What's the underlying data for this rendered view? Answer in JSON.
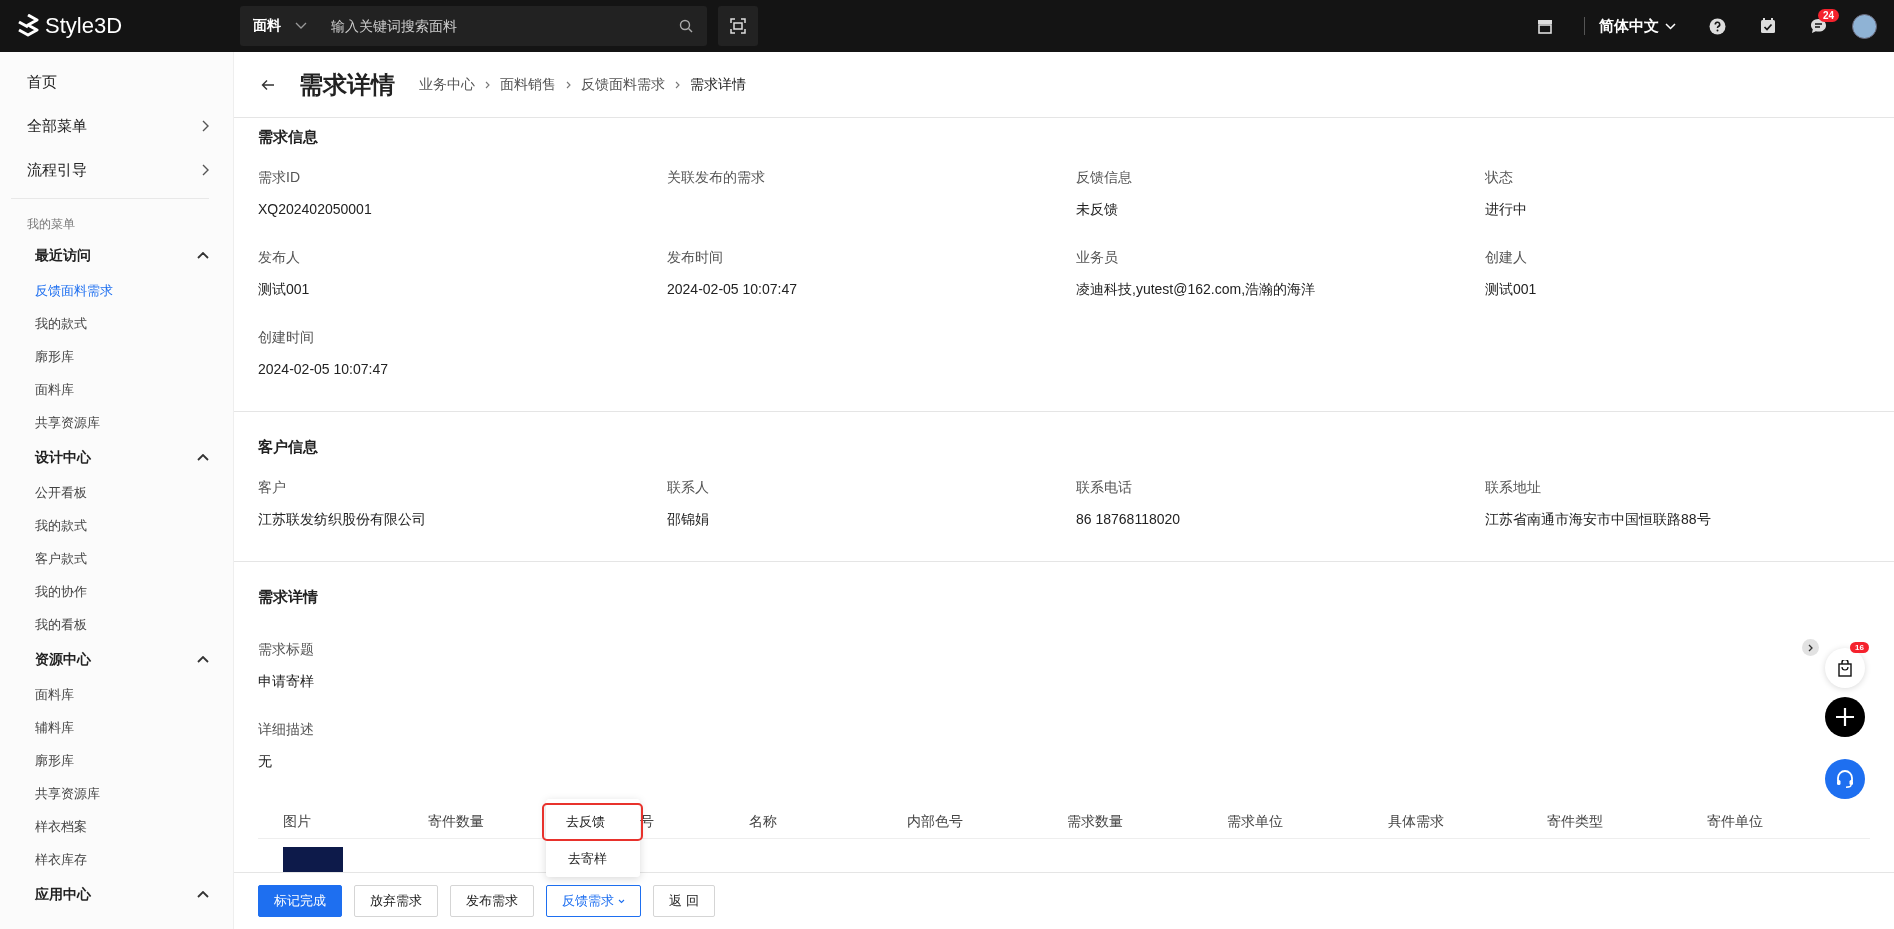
{
  "topbar": {
    "logo": "Style3D",
    "search": {
      "scope": "面料",
      "placeholder": "输入关键词搜索面料"
    },
    "language": "简体中文",
    "message_badge": "24"
  },
  "sidebar": {
    "top_items": [
      {
        "label": "首页",
        "expandable": false
      },
      {
        "label": "全部菜单",
        "expandable": true
      },
      {
        "label": "流程引导",
        "expandable": true
      }
    ],
    "section_label": "我的菜单",
    "groups": [
      {
        "title": "最近访问",
        "expanded": true,
        "items": [
          {
            "label": "反馈面料需求",
            "selected": true
          },
          {
            "label": "我的款式",
            "selected": false
          },
          {
            "label": "廓形库",
            "selected": false
          },
          {
            "label": "面料库",
            "selected": false
          },
          {
            "label": "共享资源库",
            "selected": false
          }
        ]
      },
      {
        "title": "设计中心",
        "expanded": true,
        "items": [
          {
            "label": "公开看板",
            "selected": false
          },
          {
            "label": "我的款式",
            "selected": false
          },
          {
            "label": "客户款式",
            "selected": false
          },
          {
            "label": "我的协作",
            "selected": false
          },
          {
            "label": "我的看板",
            "selected": false
          }
        ]
      },
      {
        "title": "资源中心",
        "expanded": true,
        "items": [
          {
            "label": "面料库",
            "selected": false
          },
          {
            "label": "辅料库",
            "selected": false
          },
          {
            "label": "廓形库",
            "selected": false
          },
          {
            "label": "共享资源库",
            "selected": false
          },
          {
            "label": "样衣档案",
            "selected": false
          },
          {
            "label": "样衣库存",
            "selected": false
          }
        ]
      },
      {
        "title": "应用中心",
        "expanded": true
      }
    ]
  },
  "header": {
    "title": "需求详情",
    "breadcrumb": [
      "业务中心",
      "面料销售",
      "反馈面料需求",
      "需求详情"
    ]
  },
  "sections": [
    {
      "title": "需求信息",
      "fields": [
        {
          "label": "需求ID",
          "value": "XQ202402050001"
        },
        {
          "label": "关联发布的需求"
        },
        {
          "label": "反馈信息",
          "value": "未反馈"
        },
        {
          "label": "状态",
          "value": "进行中"
        },
        {
          "label": "发布人",
          "value": "测试001"
        },
        {
          "label": "发布时间",
          "value": "2024-02-05 10:07:47"
        },
        {
          "label": "业务员",
          "value": "凌迪科技,yutest@162.com,浩瀚的海洋"
        },
        {
          "label": "创建人",
          "value": "测试001"
        },
        {
          "label": "创建时间",
          "value": "2024-02-05 10:07:47"
        }
      ]
    },
    {
      "title": "客户信息",
      "fields": [
        {
          "label": "客户",
          "value": "江苏联发纺织股份有限公司"
        },
        {
          "label": "联系人",
          "value": "邵锦娟"
        },
        {
          "label": "联系电话",
          "value": "86 18768118020"
        },
        {
          "label": "联系地址",
          "value": "江苏省南通市海安市中国恒联路88号"
        }
      ]
    }
  ],
  "detail": {
    "title": "需求详情",
    "fields": [
      {
        "label": "需求标题",
        "value": "申请寄样"
      },
      {
        "label": "详细描述",
        "value": "无"
      }
    ],
    "table": {
      "columns": [
        "图片",
        "寄件数量",
        "号",
        "名称",
        "内部色号",
        "需求数量",
        "需求单位",
        "具体需求",
        "寄件类型",
        "寄件单位"
      ]
    }
  },
  "floating": {
    "cart_badge": "16"
  },
  "actions": [
    {
      "label": "标记完成",
      "kind": "primary"
    },
    {
      "label": "放弃需求",
      "kind": "default"
    },
    {
      "label": "发布需求",
      "kind": "default"
    },
    {
      "label": "反馈需求",
      "kind": "dropdown",
      "open": true
    },
    {
      "label": "返 回",
      "kind": "default"
    }
  ],
  "dropdown_menu": [
    {
      "label": "去反馈",
      "highlighted": true
    },
    {
      "label": "去寄样",
      "highlighted": false
    }
  ]
}
